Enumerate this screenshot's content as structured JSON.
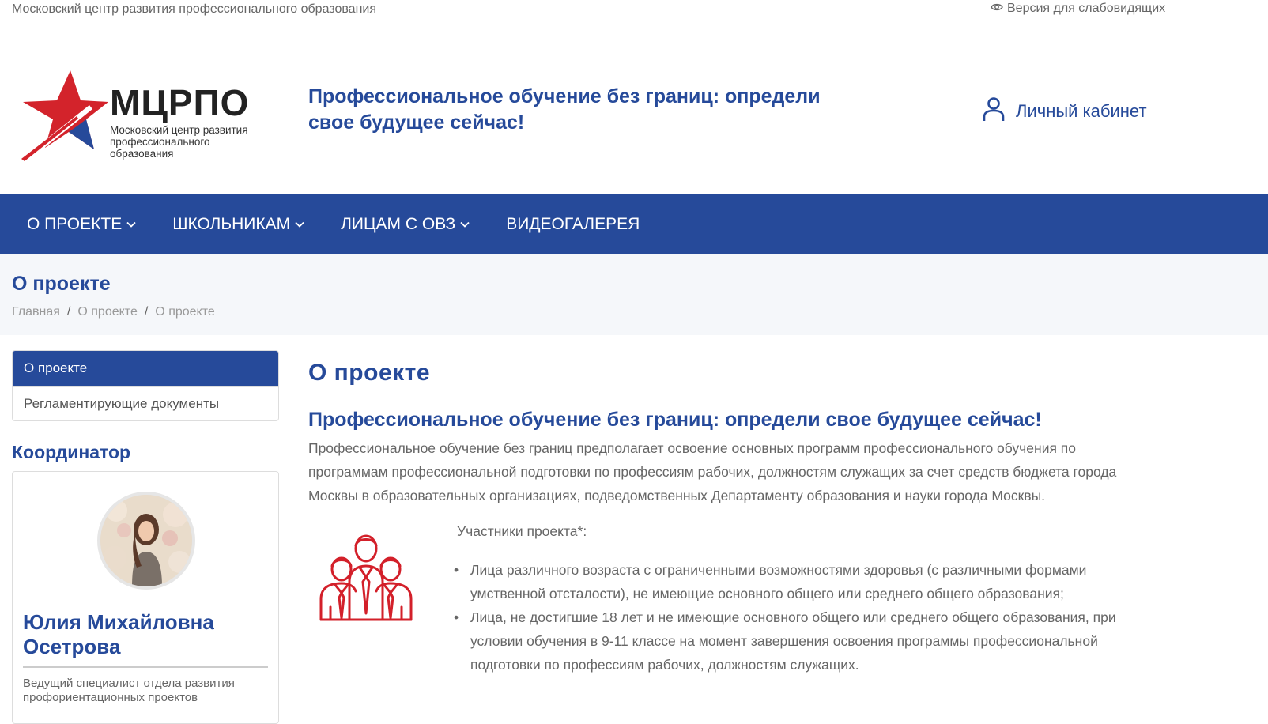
{
  "topbar": {
    "org_name": "Московский центр развития профессионального образования",
    "vision_label": "Версия для слабовидящих"
  },
  "logo": {
    "abbr": "МЦРПО",
    "full": "Московский центр развития профессионального образования"
  },
  "header": {
    "slogan": "Профессиональное обучение без границ: определи свое будущее сейчас!",
    "cabinet_label": "Личный кабинет"
  },
  "nav": {
    "items": [
      {
        "label": "О ПРОЕКТЕ"
      },
      {
        "label": "ШКОЛЬНИКАМ"
      },
      {
        "label": "ЛИЦАМ С ОВЗ"
      },
      {
        "label": "ВИДЕОГАЛЕРЕЯ"
      }
    ]
  },
  "page": {
    "title": "О проекте",
    "breadcrumbs": [
      "Главная",
      "О проекте",
      "О проекте"
    ]
  },
  "sidebar": {
    "menu": [
      {
        "label": "О проекте",
        "active": true
      },
      {
        "label": "Регламентирующие документы",
        "active": false
      }
    ],
    "coordinator_title": "Координатор",
    "coordinator": {
      "name": "Юлия Михайловна Осетрова",
      "position": "Ведущий специалист отдела развития профориентационных проектов"
    }
  },
  "content": {
    "heading": "О проекте",
    "subheading": "Профессиональное обучение без границ: определи свое будущее сейчас!",
    "lead": "Профессиональное обучение без границ предполагает освоение основных программ профессионального обучения по программам профессиональной подготовки по профессиям рабочих, должностям служащих за счет средств бюджета города Москвы в образовательных организациях, подведомственных Департаменту образования и науки города Москвы.",
    "participants_title": "Участники проекта*:",
    "participants": [
      "Лица различного возраста с ограниченными возможностями здоровья (с различными формами умственной отсталости), не имеющие основного общего или среднего общего образования;",
      "Лица, не достигшие 18 лет и не имеющие основного общего или среднего общего образования, при условии обучения в 9-11 классе на момент завершения освоения программы профессиональной подготовки по профессиям рабочих, должностям служащих."
    ]
  },
  "colors": {
    "brand_blue": "#264a9a",
    "star_red": "#d3232b",
    "icon_red": "#d3202a"
  }
}
